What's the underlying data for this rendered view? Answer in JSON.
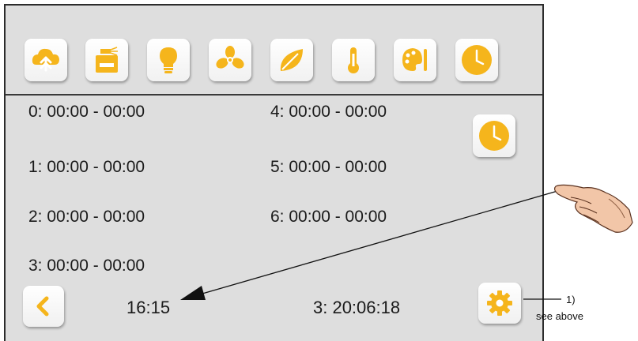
{
  "toolbar": {
    "icons": [
      "cloud-spray-icon",
      "dispenser-icon",
      "light-bulb-icon",
      "fan-icon",
      "leaf-icon",
      "thermometer-icon",
      "palette-icon",
      "clock-icon"
    ]
  },
  "timeslots": [
    {
      "label": "0: 00:00 - 00:00"
    },
    {
      "label": "1: 00:00 - 00:00"
    },
    {
      "label": "2: 00:00 - 00:00"
    },
    {
      "label": "3: 00:00 - 00:00"
    },
    {
      "label": "4: 00:00 - 00:00"
    },
    {
      "label": "5: 00:00 - 00:00"
    },
    {
      "label": "6: 00:00 - 00:00"
    }
  ],
  "footer": {
    "time": "16:15",
    "day_time": "3: 20:06:18"
  },
  "annotation": {
    "number": "1)",
    "text": "see above"
  },
  "colors": {
    "accent": "#f5b51c",
    "screen_bg": "#dedede"
  }
}
